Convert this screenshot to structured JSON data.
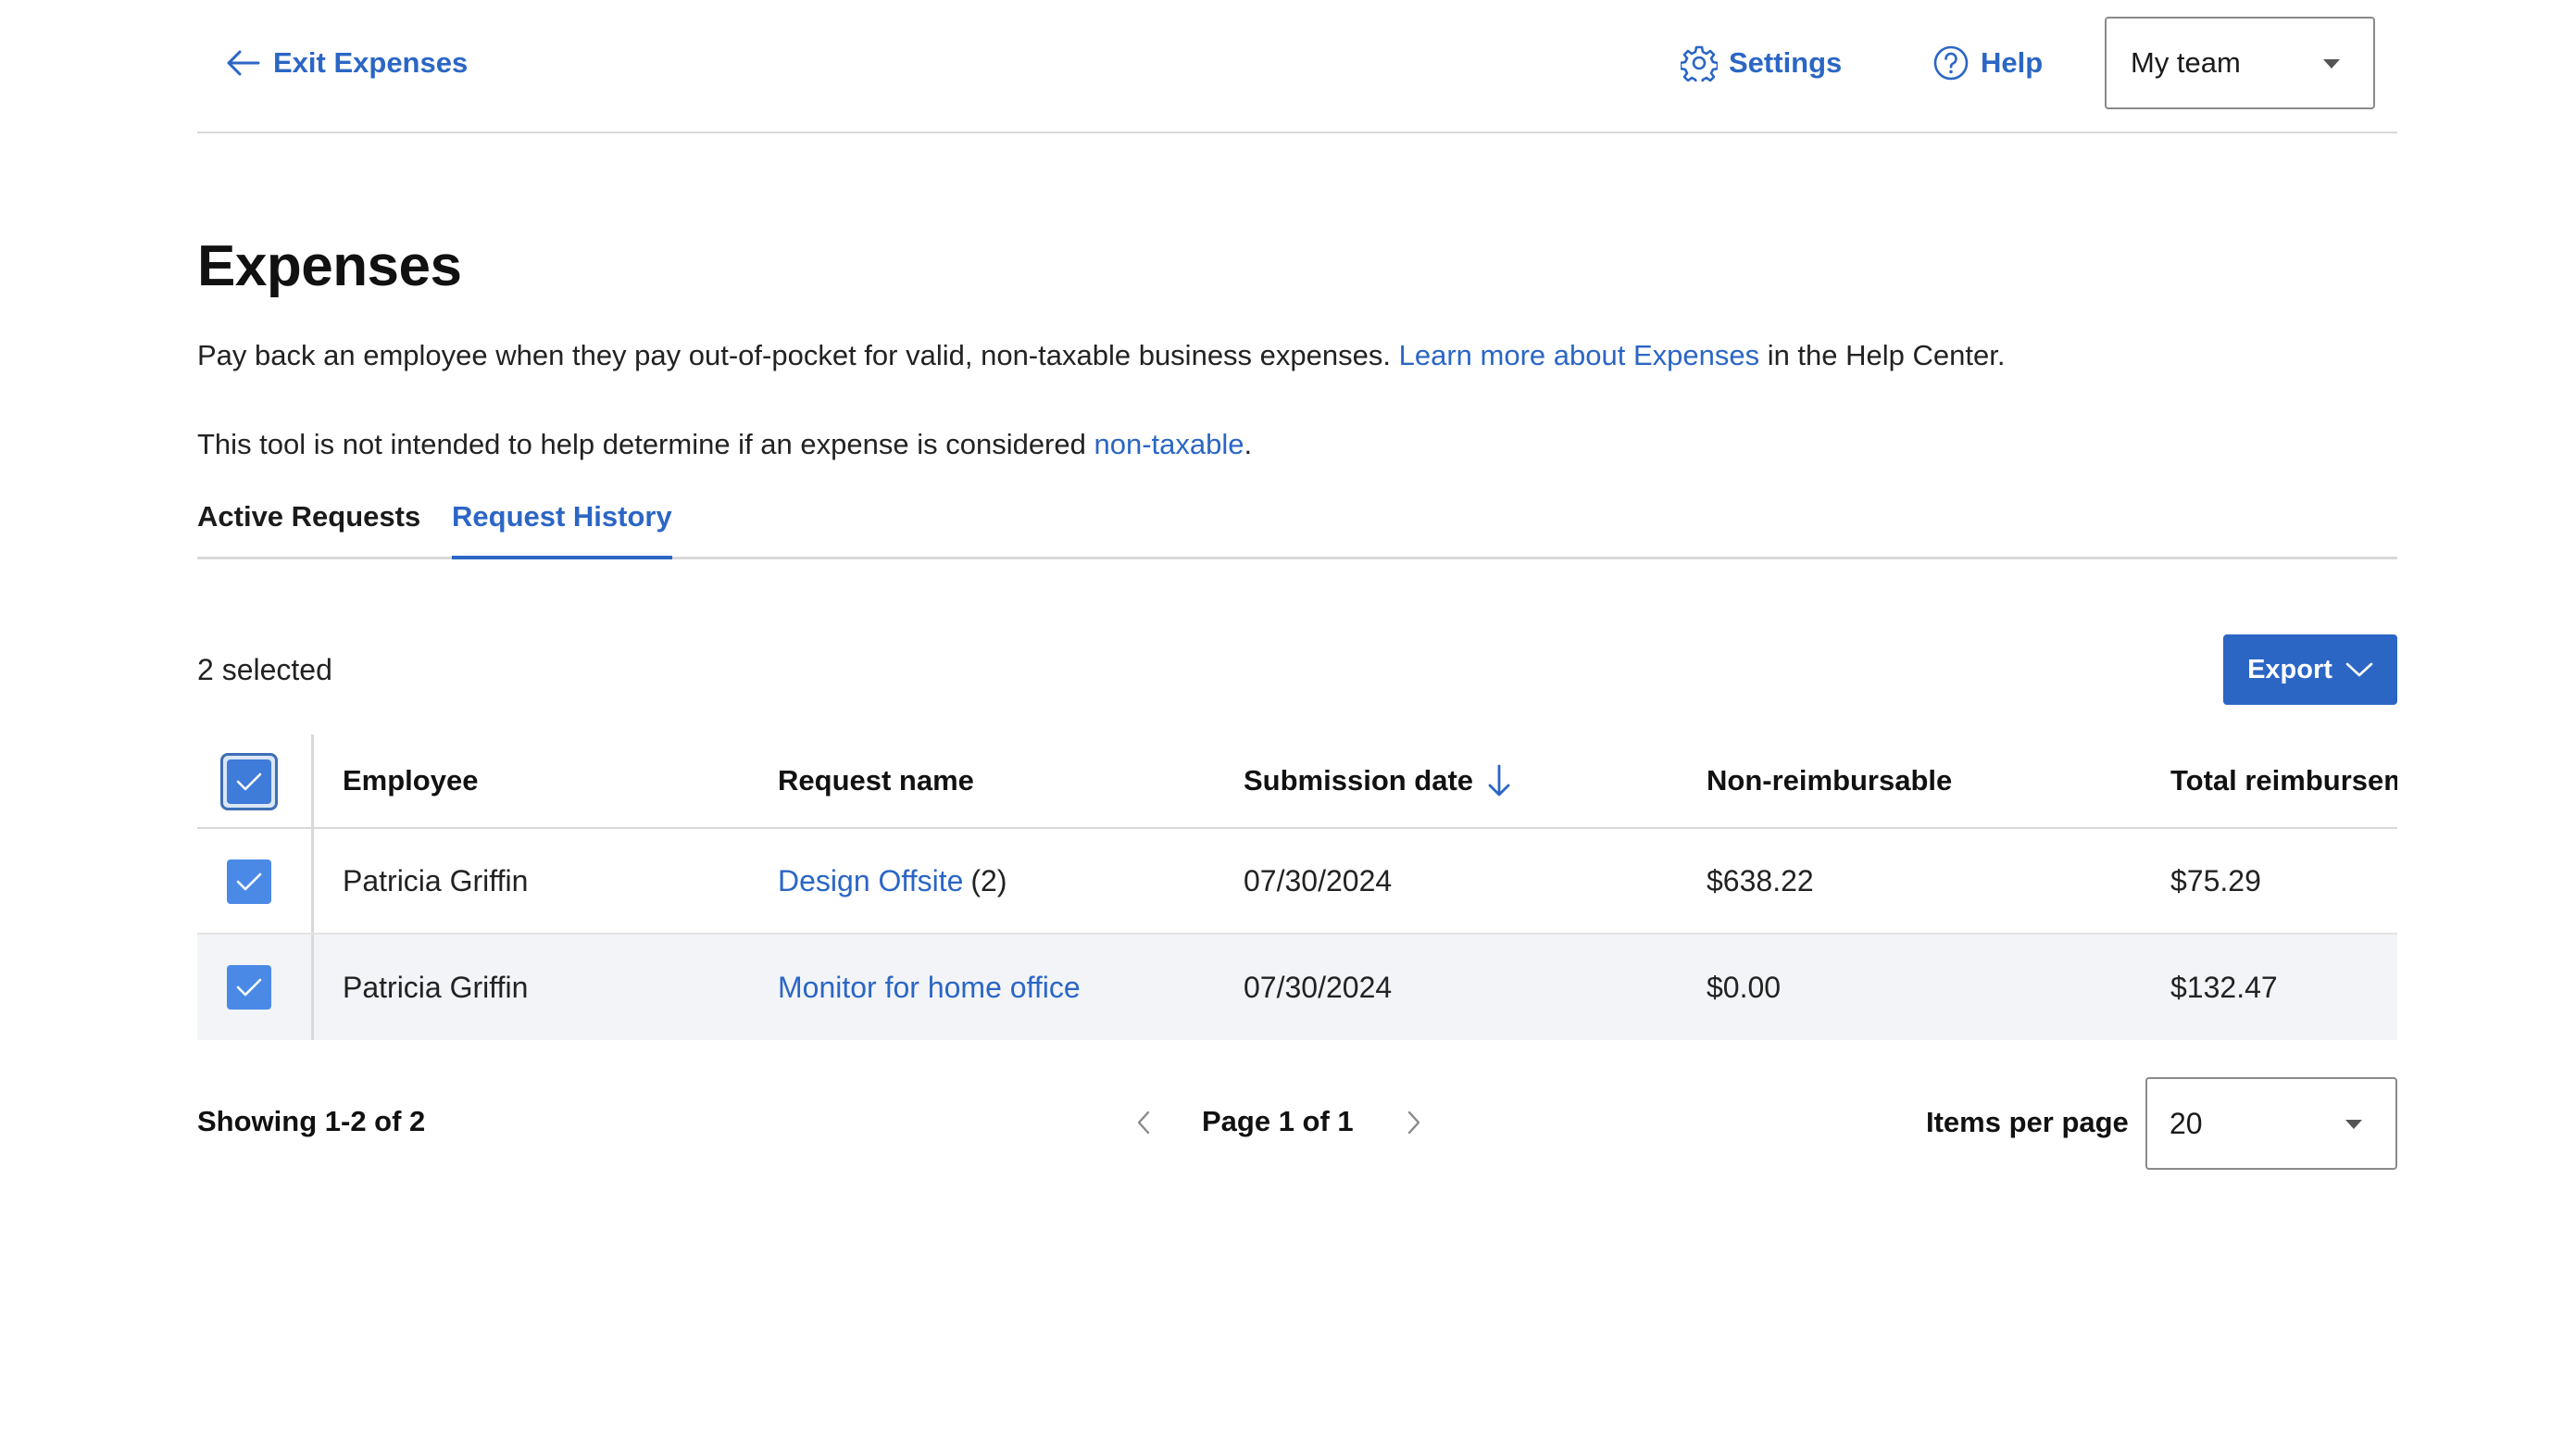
{
  "header": {
    "exit_label": "Exit Expenses",
    "settings_label": "Settings",
    "help_label": "Help",
    "team_select_value": "My team"
  },
  "page": {
    "title": "Expenses",
    "description_1_text": "Pay back an employee when they pay out-of-pocket for valid, non-taxable business expenses. ",
    "description_1_link": "Learn more about Expenses",
    "description_1_tail": " in the Help Center.",
    "description_2_text": "This tool is not intended to help determine if an expense is considered ",
    "description_2_link": "non-taxable",
    "description_2_tail": "."
  },
  "tabs": [
    {
      "label": "Active Requests",
      "active": false
    },
    {
      "label": "Request History",
      "active": true
    }
  ],
  "selection": {
    "count_label": "2 selected",
    "export_label": "Export"
  },
  "table": {
    "columns": [
      "Employee",
      "Request name",
      "Submission date",
      "Non-reimbursable",
      "Total reimbursement"
    ],
    "rows": [
      {
        "employee": "Patricia Griffin",
        "request_name": "Design Offsite",
        "request_count": "(2)",
        "submission_date": "07/30/2024",
        "non_reimbursable": "$638.22",
        "total": "$75.29",
        "checked": true
      },
      {
        "employee": "Patricia Griffin",
        "request_name": "Monitor for home office",
        "request_count": "",
        "submission_date": "07/30/2024",
        "non_reimbursable": "$0.00",
        "total": "$132.47",
        "checked": true
      }
    ]
  },
  "footer": {
    "showing_label": "Showing 1-2 of 2",
    "page_label": "Page 1 of 1",
    "items_per_page_label": "Items per page",
    "items_per_page_value": "20"
  },
  "colors": {
    "accent": "#2b66c5",
    "checkbox": "#4a8ae6",
    "row_alt": "#f2f4f7"
  }
}
